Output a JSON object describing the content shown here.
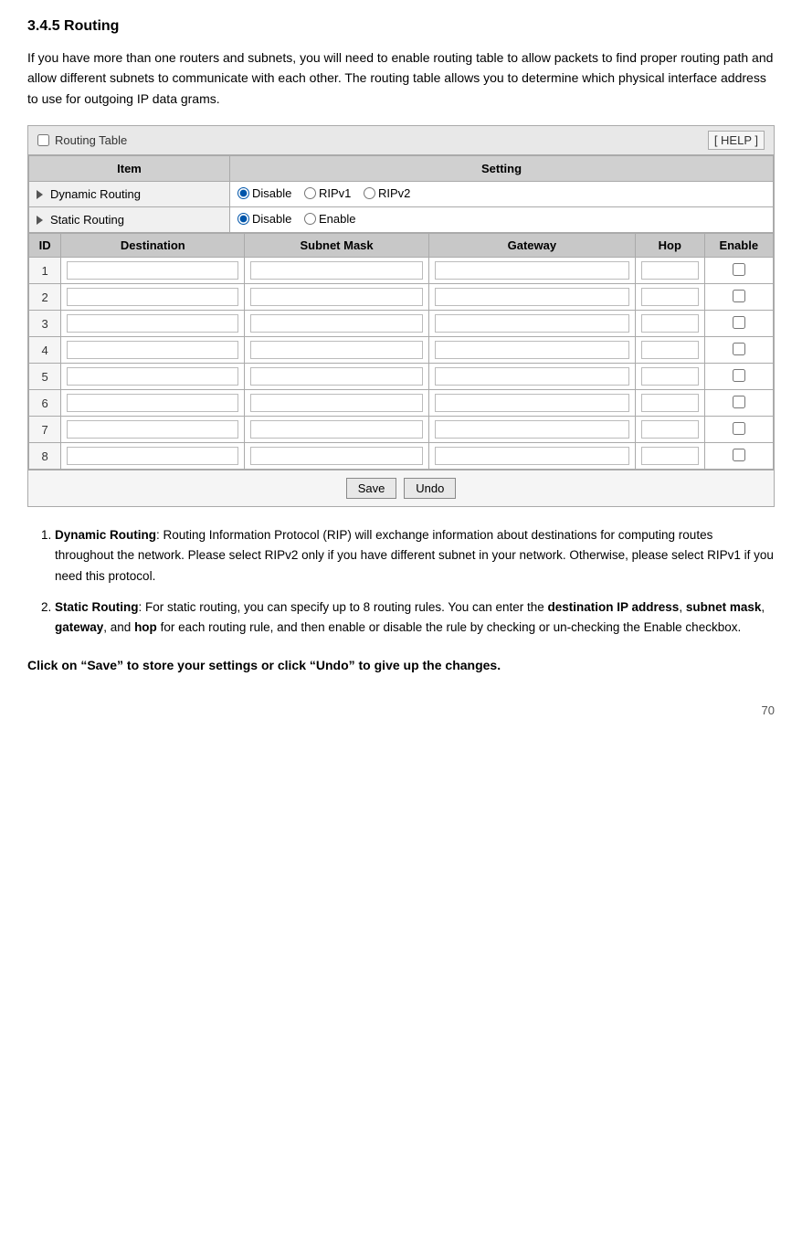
{
  "page": {
    "title": "3.4.5 Routing",
    "intro": "If you have more than one routers and subnets, you will need to enable routing table to allow packets to find proper routing path and allow different subnets to communicate with each other. The routing table allows you to determine which physical interface address to use for outgoing IP data grams.",
    "table": {
      "title": "Routing Table",
      "help_label": "[ HELP ]",
      "columns": {
        "item": "Item",
        "setting": "Setting"
      },
      "dynamic_routing": {
        "label": "Dynamic Routing",
        "options": [
          "Disable",
          "RIPv1",
          "RIPv2"
        ],
        "selected": "Disable"
      },
      "static_routing": {
        "label": "Static Routing",
        "options": [
          "Disable",
          "Enable"
        ],
        "selected": "Disable"
      },
      "static_cols": {
        "id": "ID",
        "destination": "Destination",
        "subnet_mask": "Subnet Mask",
        "gateway": "Gateway",
        "hop": "Hop",
        "enable": "Enable"
      },
      "rows": [
        {
          "id": 1
        },
        {
          "id": 2
        },
        {
          "id": 3
        },
        {
          "id": 4
        },
        {
          "id": 5
        },
        {
          "id": 6
        },
        {
          "id": 7
        },
        {
          "id": 8
        }
      ],
      "buttons": {
        "save": "Save",
        "undo": "Undo"
      }
    },
    "notes": [
      {
        "term": "Dynamic Routing",
        "text": ": Routing Information Protocol (RIP) will exchange information about destinations for computing routes throughout the network. Please select RIPv2 only if you have different subnet in your network. Otherwise, please select RIPv1 if you need this protocol."
      },
      {
        "term": "Static Routing",
        "text": ": For static routing, you can specify up to 8 routing rules. You can enter the ",
        "parts": [
          {
            "bold": "destination IP address"
          },
          {
            "normal": ", "
          },
          {
            "bold": "subnet mask"
          },
          {
            "normal": ", "
          },
          {
            "bold": "gateway"
          },
          {
            "normal": ", and "
          },
          {
            "bold": "hop"
          },
          {
            "normal": " for each routing rule, and then enable or disable the rule by checking or un-checking the Enable checkbox."
          }
        ]
      }
    ],
    "footer_note": "Click on “Save” to store your settings or click “Undo” to give up the changes.",
    "page_number": "70"
  }
}
